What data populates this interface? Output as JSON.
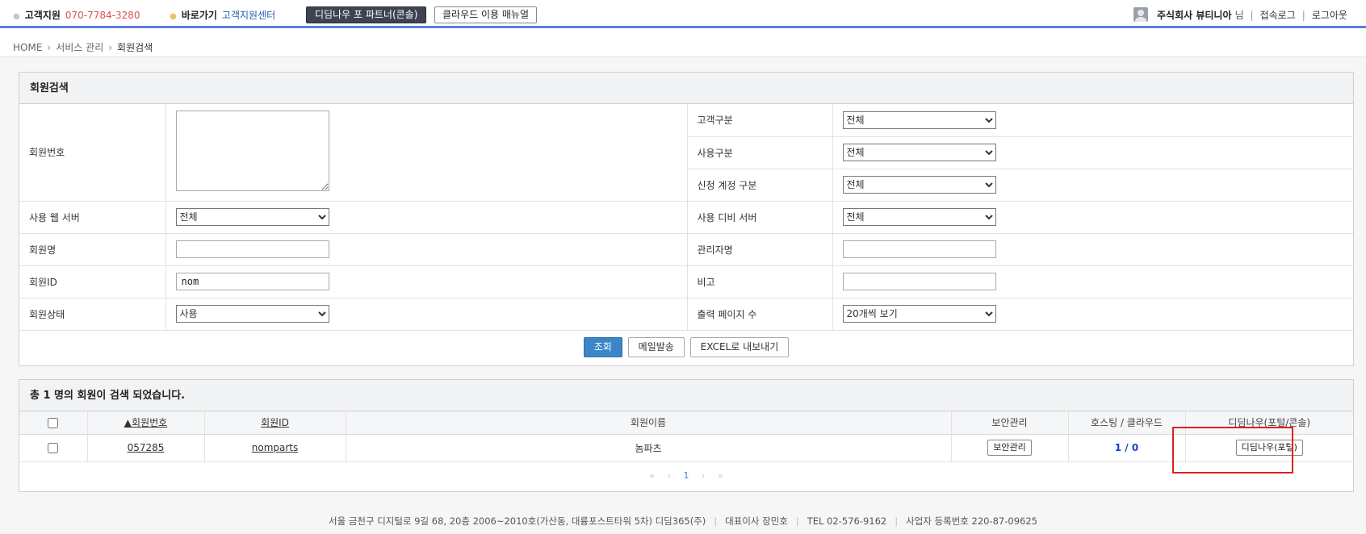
{
  "topbar": {
    "support_label": "고객지원",
    "support_phone": "070-7784-3280",
    "shortcut_label": "바로가기",
    "shortcut_link": "고객지원센터",
    "partner_button": "디딤나우 포 파트너(콘솔)",
    "manual_button": "클라우드 이용 매뉴얼",
    "company_name": "주식회사 뷰티니아",
    "honorific": "님",
    "access_log": "접속로그",
    "logout": "로그아웃",
    "accent_color": "#5b7fd6"
  },
  "breadcrumb": [
    "HOME",
    "서비스 관리",
    "회원검색"
  ],
  "search_panel": {
    "title": "회원검색",
    "fields": {
      "member_no": {
        "label": "회원번호",
        "value": ""
      },
      "customer_type": {
        "label": "고객구분",
        "value": "전체"
      },
      "usage_type": {
        "label": "사용구분",
        "value": "전체"
      },
      "account_type": {
        "label": "신청 계정 구분",
        "value": "전체"
      },
      "web_server": {
        "label": "사용 웹 서버",
        "value": "전체"
      },
      "db_server": {
        "label": "사용 디비 서버",
        "value": "전체"
      },
      "member_name": {
        "label": "회원명",
        "value": ""
      },
      "admin_name": {
        "label": "관리자명",
        "value": ""
      },
      "member_id": {
        "label": "회원ID",
        "value": "nom"
      },
      "note": {
        "label": "비고",
        "value": ""
      },
      "member_status": {
        "label": "회원상태",
        "value": "사용"
      },
      "page_size": {
        "label": "출력 페이지 수",
        "value": "20개씩 보기"
      }
    },
    "buttons": {
      "search": "조회",
      "mail": "메일발송",
      "excel": "EXCEL로 내보내기"
    }
  },
  "results": {
    "summary": "총 1 명의 회원이 검색 되었습니다.",
    "columns": [
      "▲회원번호",
      "회원ID",
      "회원이름",
      "보안관리",
      "호스팅 / 클라우드",
      "디딤나우(포털/콘솔)"
    ],
    "rows": [
      {
        "member_no": "057285",
        "member_id": "nomparts",
        "member_name": "놈파츠",
        "security_button": "보안관리",
        "hosting": "1 / 0",
        "portal_button": "디딤나우(포털)"
      }
    ],
    "pager": {
      "first": "«",
      "prev": "‹",
      "current": "1",
      "next": "›",
      "last": "»"
    }
  },
  "footer": {
    "address": "서울 금천구 디지털로 9길 68, 20층 2006~2010호(가산동, 대륭포스트타워 5차) 디딤365(주)",
    "ceo": "대표이사 장민호",
    "tel": "TEL 02-576-9162",
    "biz_no": "사업자 등록번호 220-87-09625"
  }
}
